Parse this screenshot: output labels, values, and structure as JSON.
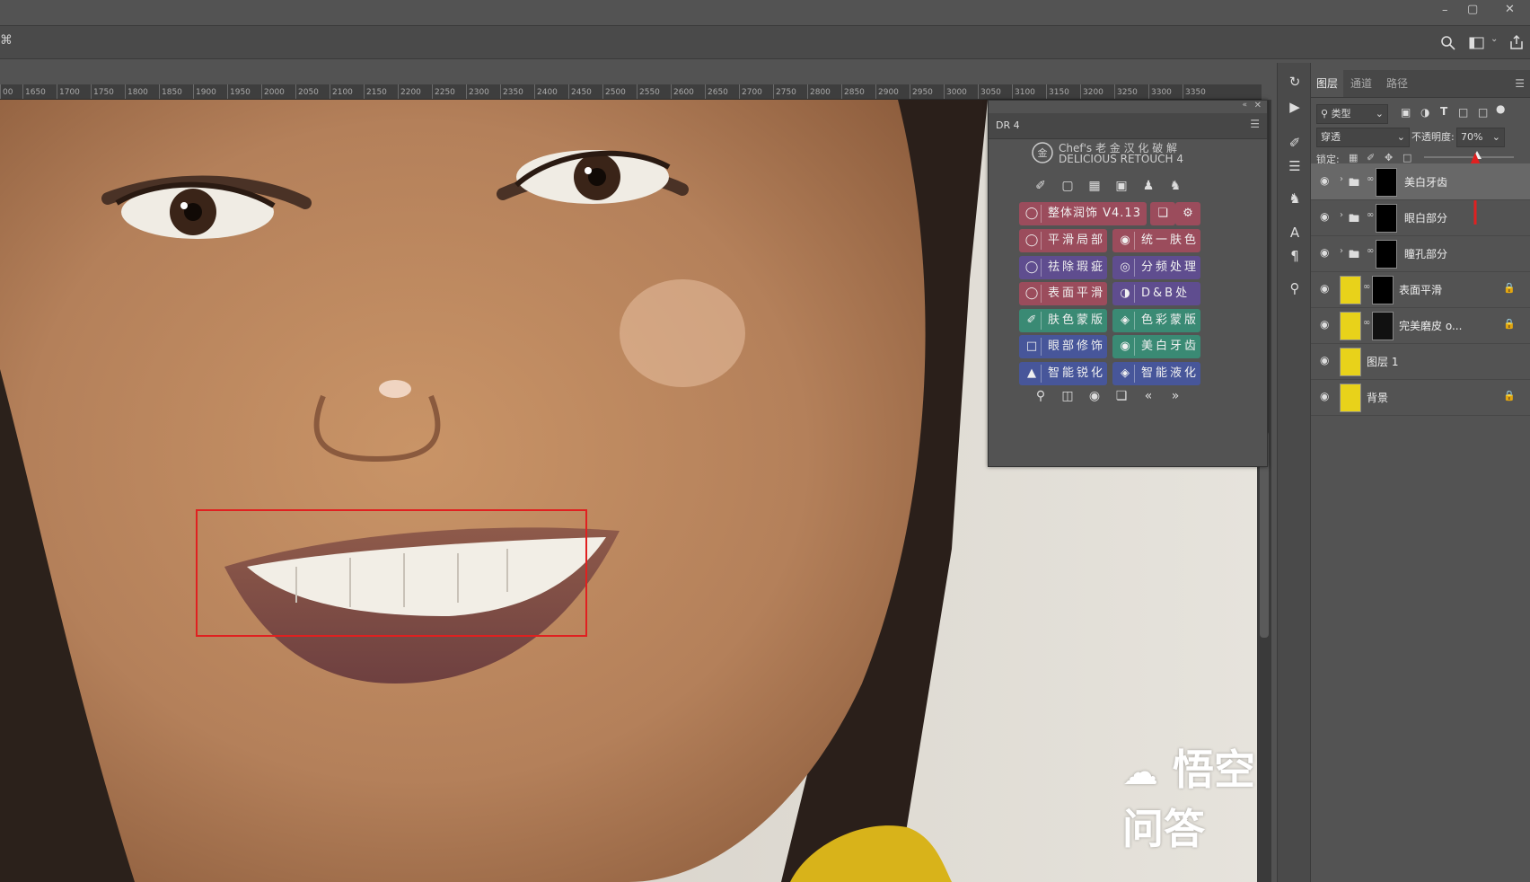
{
  "window": {
    "controls": [
      "–",
      "▢",
      "✕"
    ]
  },
  "ruler": {
    "ticks": [
      "00",
      "1650",
      "1700",
      "1750",
      "1800",
      "1850",
      "1900",
      "1950",
      "2000",
      "2050",
      "2100",
      "2150",
      "2200",
      "2250",
      "2300",
      "2350",
      "2400",
      "2450",
      "2500",
      "2550",
      "2600",
      "2650",
      "2700",
      "2750",
      "2800",
      "2850",
      "2900",
      "2950",
      "3000",
      "3050",
      "3100",
      "3150",
      "3200",
      "3250",
      "3300",
      "3350"
    ]
  },
  "dr4": {
    "tab_label": "DR 4",
    "brand_line1": "Chef's 老 金 汉 化 破 解",
    "brand_line2": "DELICIOUS RETOUCH 4",
    "version_label": "整体润饰 V4.13",
    "buttons": [
      {
        "label": "平滑局部",
        "color": "red"
      },
      {
        "label": "统一肤色",
        "color": "red"
      },
      {
        "label": "祛除瑕疵",
        "color": "purple"
      },
      {
        "label": "分频处理",
        "color": "purple"
      },
      {
        "label": "表面平滑",
        "color": "red"
      },
      {
        "label": "D&B处理",
        "color": "purple"
      },
      {
        "label": "肤色蒙版",
        "color": "green"
      },
      {
        "label": "色彩蒙版",
        "color": "green"
      },
      {
        "label": "眼部修饰",
        "color": "blue"
      },
      {
        "label": "美白牙齿",
        "color": "green"
      },
      {
        "label": "智能锐化",
        "color": "blue"
      },
      {
        "label": "智能液化",
        "color": "blue"
      }
    ]
  },
  "layers_panel": {
    "tabs": [
      "图层",
      "通道",
      "路径"
    ],
    "filter_label": "类型",
    "blend_mode": "穿透",
    "opacity_label": "不透明度:",
    "opacity_value": "70%",
    "lock_label": "锁定:",
    "layers": [
      {
        "name": "美白牙齿",
        "kind": "group",
        "selected": true
      },
      {
        "name": "眼白部分",
        "kind": "group",
        "selected": false
      },
      {
        "name": "瞳孔部分",
        "kind": "group",
        "selected": false
      },
      {
        "name": "表面平滑",
        "kind": "layer",
        "locked": true
      },
      {
        "name": "完美磨皮 o...",
        "kind": "layer",
        "locked": true
      },
      {
        "name": "图层 1",
        "kind": "layer",
        "locked": false
      },
      {
        "name": "背景",
        "kind": "layer",
        "locked": true
      }
    ]
  },
  "watermark": {
    "text": "悟空问答"
  },
  "annotation": {
    "box_color": "#e02020",
    "arrow_color": "#e02020"
  }
}
